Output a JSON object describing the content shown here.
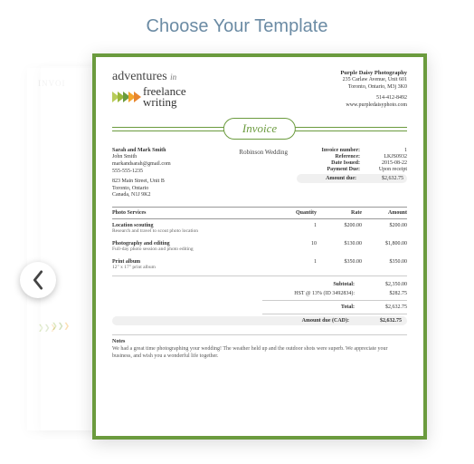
{
  "header": {
    "title": "Choose Your Template"
  },
  "ghost": {
    "label": "INVOI"
  },
  "logo": {
    "word1": "adventures",
    "word2": "in",
    "script1": "freelance",
    "script2": "writing"
  },
  "company": {
    "name": "Purple Daisy Photography",
    "addr1": "235 Carlaw Avenue, Unit 601",
    "addr2": "Toronto, Ontario, M3j 3K0",
    "phone": "514-412-8492",
    "url": "www.purpledaisyphoto.com"
  },
  "badge": {
    "label": "Invoice"
  },
  "bill": {
    "name": "Sarah and Mark Smith",
    "contact": "John Smith",
    "email": "markandsarah@gmail.com",
    "phone": "555-555-1235",
    "addr1": "823 Main Street, Unit B",
    "addr2": "Toronto, Ontario",
    "addr3": "Canada, N1J 9K2"
  },
  "event": "Robinson Wedding",
  "meta": {
    "invoice_no_lbl": "Invoice number:",
    "invoice_no": "1",
    "reference_lbl": "Reference:",
    "reference": "LKJS0932",
    "date_lbl": "Date Issued:",
    "date": "2015-08-22",
    "payment_lbl": "Payment Due:",
    "payment": "Upon receipt",
    "amount_lbl": "Amount due:",
    "amount": "$2,632.75"
  },
  "columns": {
    "desc": "Photo Services",
    "qty": "Quantity",
    "rate": "Rate",
    "amt": "Amount"
  },
  "items": [
    {
      "title": "Location scouting",
      "sub": "Research and travel to scout photo location",
      "qty": "1",
      "rate": "$200.00",
      "amt": "$200.00"
    },
    {
      "title": "Photography and editing",
      "sub": "Full-day photo session and photo editing",
      "qty": "10",
      "rate": "$130.00",
      "amt": "$1,800.00"
    },
    {
      "title": "Print album",
      "sub": "12\" x 17\" print album",
      "qty": "1",
      "rate": "$350.00",
      "amt": "$350.00"
    }
  ],
  "totals": {
    "subtotal_lbl": "Subtotal:",
    "subtotal": "$2,350.00",
    "tax_lbl": "HST @ 13% (ID 3492834):",
    "tax": "$282.75",
    "total_lbl": "Total:",
    "total": "$2,632.75",
    "due_lbl": "Amount due (CAD):",
    "due": "$2,632.75"
  },
  "notes": {
    "title": "Notes",
    "body": "We had a great time photographing your wedding! The weather held up and the outdoor shots were superb. We appreciate your business, and wish you a wonderful life together."
  }
}
